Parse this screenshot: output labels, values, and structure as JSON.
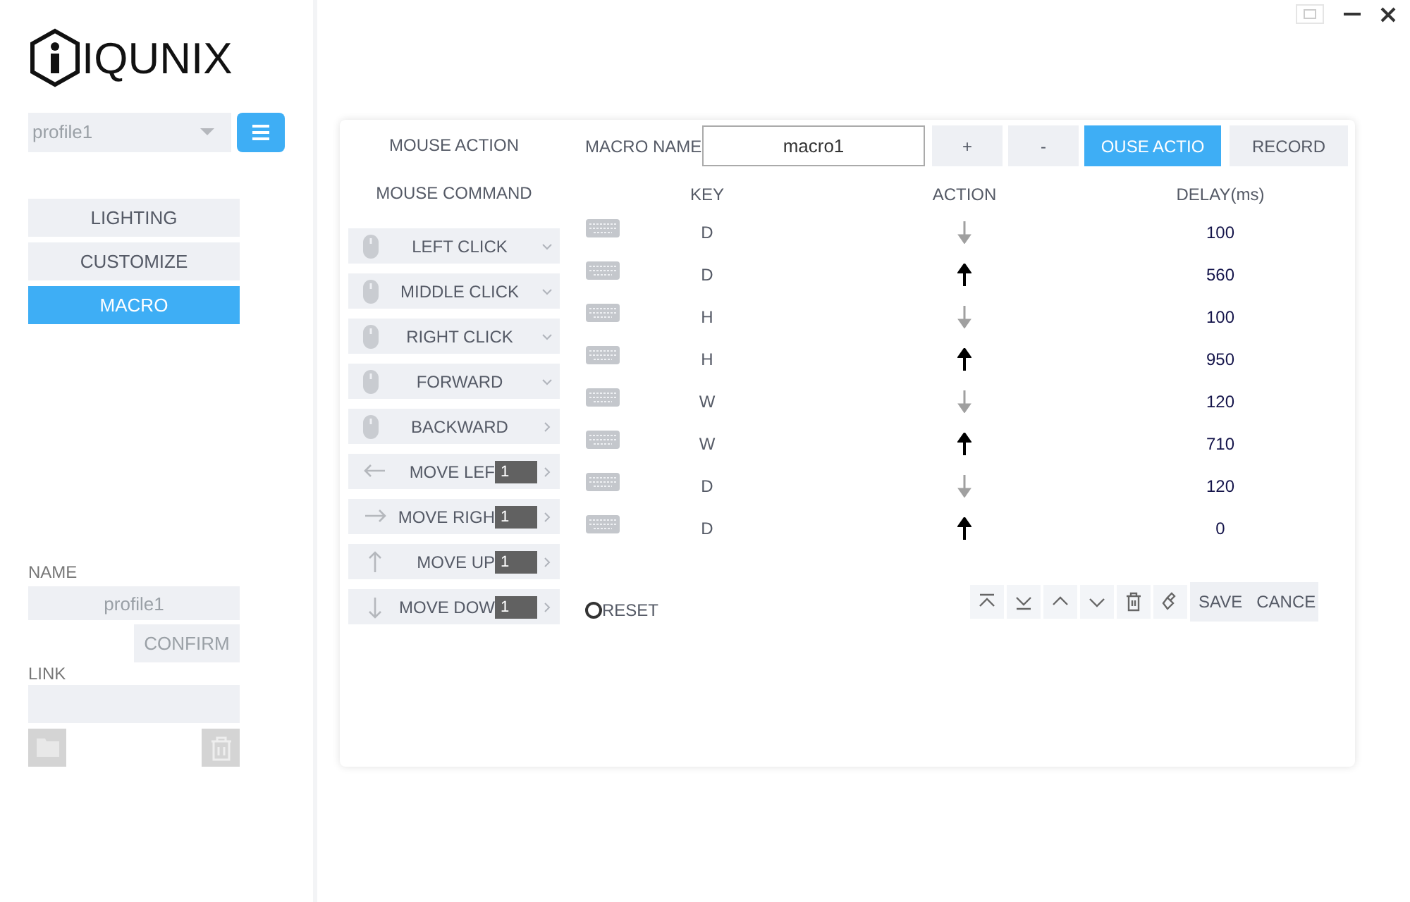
{
  "logo": {
    "text": "IQUNIX"
  },
  "profile_select": {
    "value": "profile1"
  },
  "nav": [
    {
      "label": "LIGHTING",
      "selected": false
    },
    {
      "label": "CUSTOMIZE",
      "selected": false
    },
    {
      "label": "MACRO",
      "selected": true
    }
  ],
  "name_field": {
    "label": "NAME",
    "placeholder": "profile1"
  },
  "confirm_button": "CONFIRM",
  "link_field": {
    "label": "LINK"
  },
  "mouse_panel": {
    "title": "MOUSE ACTION",
    "subtitle": "MOUSE COMMAND",
    "items": [
      {
        "kind": "dropdown",
        "label": "LEFT CLICK"
      },
      {
        "kind": "dropdown",
        "label": "MIDDLE CLICK"
      },
      {
        "kind": "dropdown",
        "label": "RIGHT CLICK"
      },
      {
        "kind": "dropdown",
        "label": "FORWARD"
      },
      {
        "kind": "submenu",
        "label": "BACKWARD"
      },
      {
        "kind": "move",
        "label": "MOVE LEF",
        "count": "1"
      },
      {
        "kind": "move",
        "label": "MOVE RIGH",
        "count": "1"
      },
      {
        "kind": "move",
        "label": "MOVE UP",
        "count": "1"
      },
      {
        "kind": "move",
        "label": "MOVE DOW",
        "count": "1"
      }
    ]
  },
  "macro": {
    "name_label": "MACRO NAME",
    "name_value": "macro1",
    "buttons": [
      {
        "label": "+",
        "selected": false
      },
      {
        "label": "-",
        "selected": false
      },
      {
        "label": "OUSE ACTIO",
        "selected": true
      },
      {
        "label": "RECORD",
        "selected": false
      }
    ],
    "columns": [
      "KEY",
      "ACTION",
      "DELAY(ms)"
    ],
    "rows": [
      {
        "key": "D",
        "kind": "down",
        "delay": "100"
      },
      {
        "key": "D",
        "kind": "up",
        "delay": "560"
      },
      {
        "key": "H",
        "kind": "down",
        "delay": "100"
      },
      {
        "key": "H",
        "kind": "up",
        "delay": "950"
      },
      {
        "key": "W",
        "kind": "down",
        "delay": "120"
      },
      {
        "key": "W",
        "kind": "up",
        "delay": "710"
      },
      {
        "key": "D",
        "kind": "down",
        "delay": "120"
      },
      {
        "key": "D",
        "kind": "up",
        "delay": "0"
      }
    ],
    "reset": "RESET",
    "save": "SAVE",
    "cancel": "CANCE"
  }
}
